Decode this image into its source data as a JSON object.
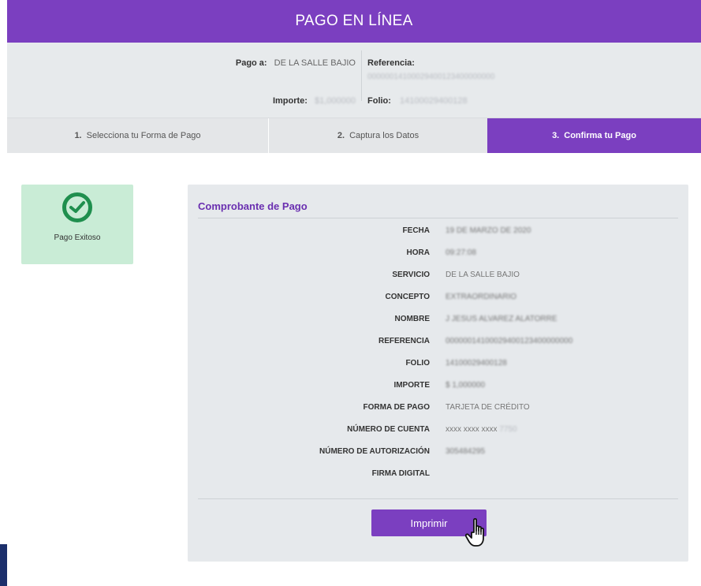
{
  "header": {
    "title": "PAGO EN LÍNEA"
  },
  "info": {
    "pago_a_label": "Pago a:",
    "pago_a_value": "DE LA SALLE BAJIO",
    "importe_label": "Importe:",
    "importe_value": "$1,000000",
    "referencia_label": "Referencia:",
    "referencia_value": "00000014100029400123400000000",
    "folio_label": "Folio:",
    "folio_value": "14100029400128"
  },
  "steps": [
    {
      "num": "1.",
      "label": "Selecciona tu Forma de Pago",
      "active": false
    },
    {
      "num": "2.",
      "label": "Captura los Datos",
      "active": false
    },
    {
      "num": "3.",
      "label": "Confirma tu Pago",
      "active": true
    }
  ],
  "status": {
    "label": "Pago Exitoso"
  },
  "receipt": {
    "title": "Comprobante de Pago",
    "rows": [
      {
        "key": "FECHA",
        "value": "19 DE MARZO DE 2020"
      },
      {
        "key": "HORA",
        "value": "09:27:08"
      },
      {
        "key": "SERVICIO",
        "value": "DE LA SALLE BAJIO"
      },
      {
        "key": "CONCEPTO",
        "value": "EXTRAORDINARIO"
      },
      {
        "key": "NOMBRE",
        "value": "J JESUS ALVAREZ ALATORRE"
      },
      {
        "key": "REFERENCIA",
        "value": "00000014100029400123400000000"
      },
      {
        "key": "FOLIO",
        "value": "14100029400128"
      },
      {
        "key": "IMPORTE",
        "value": "$ 1,000000"
      },
      {
        "key": "FORMA DE PAGO",
        "value": "TARJETA DE CRÉDITO"
      },
      {
        "key": "NÚMERO DE CUENTA",
        "value": "xxxx xxxx xxxx",
        "extra": "7750"
      },
      {
        "key": "NÚMERO DE AUTORIZACIÓN",
        "value": "305484295"
      },
      {
        "key": "FIRMA DIGITAL",
        "value": ""
      }
    ],
    "print_label": "Imprimir"
  },
  "colors": {
    "primary": "#7b3fc0",
    "success_bg": "#c9ecd6",
    "success_icon": "#1f8f4e",
    "panel_bg": "#e6e9ec"
  },
  "icons": {
    "success": "check-circle-icon",
    "cursor": "hand-pointer-icon"
  }
}
